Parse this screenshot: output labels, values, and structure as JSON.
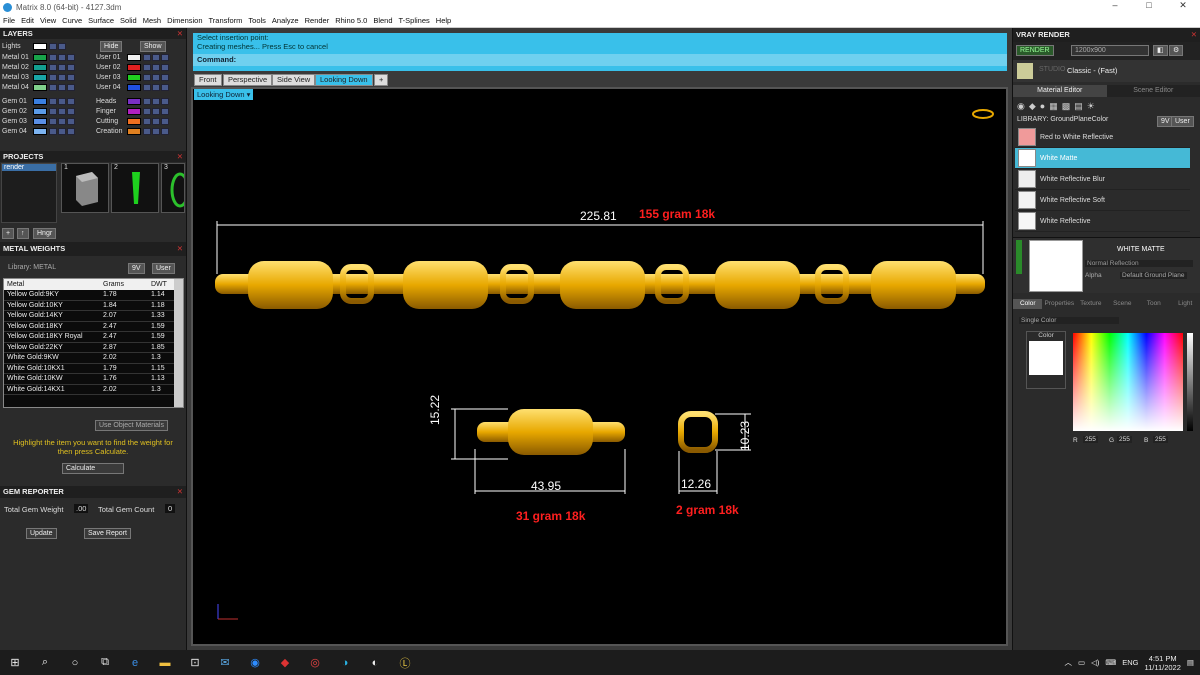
{
  "window": {
    "title": "Matrix 8.0 (64-bit) - 4127.3dm",
    "min": "–",
    "max": "□",
    "close": "✕"
  },
  "menu": [
    "File",
    "Edit",
    "View",
    "Curve",
    "Surface",
    "Solid",
    "Mesh",
    "Dimension",
    "Transform",
    "Tools",
    "Analyze",
    "Render",
    "Rhino 5.0",
    "Blend",
    "T-Splines",
    "Help"
  ],
  "layers": {
    "title": "LAYERS",
    "lights": "Lights",
    "hide": "Hide",
    "show": "Show",
    "col1": [
      {
        "name": "Metal 01",
        "color": "#18a34a"
      },
      {
        "name": "Metal 02",
        "color": "#139f8f"
      },
      {
        "name": "Metal 03",
        "color": "#19a5a5"
      },
      {
        "name": "Metal 04",
        "color": "#7fd08a"
      },
      {
        "name": "Gem 01",
        "color": "#3a7fe0"
      },
      {
        "name": "Gem 02",
        "color": "#5b9be8"
      },
      {
        "name": "Gem 03",
        "color": "#5a8fe6"
      },
      {
        "name": "Gem 04",
        "color": "#7cb3f0"
      }
    ],
    "col2": [
      {
        "name": "User 01",
        "color": "#f0f0f0"
      },
      {
        "name": "User 02",
        "color": "#e02020"
      },
      {
        "name": "User 03",
        "color": "#20d020"
      },
      {
        "name": "User 04",
        "color": "#2050e0"
      },
      {
        "name": "Heads",
        "color": "#7a2fc4"
      },
      {
        "name": "Finger",
        "color": "#b020c0"
      },
      {
        "name": "Cutting",
        "color": "#f07020"
      },
      {
        "name": "Creation",
        "color": "#e08020"
      }
    ]
  },
  "projects": {
    "title": "PROJECTS",
    "item": "render",
    "thumbs": [
      "1",
      "2",
      "3"
    ],
    "hingr": "Hngr"
  },
  "metal_weights": {
    "title": "METAL WEIGHTS",
    "library": "Library: METAL",
    "9v": "9V",
    "user": "User",
    "headers": [
      "Metal",
      "Grams",
      "DWT"
    ],
    "rows": [
      [
        "Yellow Gold:9KY",
        "1.78",
        "1.14"
      ],
      [
        "Yellow Gold:10KY",
        "1.84",
        "1.18"
      ],
      [
        "Yellow Gold:14KY",
        "2.07",
        "1.33"
      ],
      [
        "Yellow Gold:18KY",
        "2.47",
        "1.59"
      ],
      [
        "Yellow Gold:18KY Royal",
        "2.47",
        "1.59"
      ],
      [
        "Yellow Gold:22KY",
        "2.87",
        "1.85"
      ],
      [
        "White Gold:9KW",
        "2.02",
        "1.3"
      ],
      [
        "White Gold:10KX1",
        "1.79",
        "1.15"
      ],
      [
        "White Gold:10KW",
        "1.76",
        "1.13"
      ],
      [
        "White Gold:14KX1",
        "2.02",
        "1.3"
      ]
    ],
    "use_object": "Use Object Materials",
    "hint": "Highlight the item you want to find the weight for then press Calculate.",
    "calculate": "Calculate"
  },
  "gem_reporter": {
    "title": "GEM REPORTER",
    "total_weight_label": "Total Gem Weight",
    "total_weight": ".00",
    "total_count_label": "Total Gem Count",
    "total_count": "0",
    "update": "Update",
    "save": "Save Report"
  },
  "command": {
    "line1": "Select insertion point:",
    "line2": "Creating meshes... Press Esc to cancel",
    "label": "Command:"
  },
  "tabs": [
    "Front",
    "Perspective",
    "Side View",
    "Looking Down"
  ],
  "viewport_label": "Looking Down",
  "dims": {
    "total": "225.81",
    "total_weight": "155 gram 18k",
    "h1": "15.22",
    "w1": "43.95",
    "w1_weight": "31 gram 18k",
    "h2": "10.23",
    "w2": "12.26",
    "w2_weight": "2 gram 18k"
  },
  "vray": {
    "title": "VRAY RENDER",
    "render": "RENDER",
    "size": "1200x900",
    "preset_a": "STUDIO",
    "preset": "Classic - (Fast)",
    "tab1": "Material Editor",
    "tab2": "Scene Editor",
    "library": "LIBRARY: GroundPlaneColor",
    "9v": "9V",
    "user": "User",
    "materials": [
      {
        "name": "Red to White Reflective",
        "color": "#f09a9a"
      },
      {
        "name": "White Matte",
        "color": "#ffffff"
      },
      {
        "name": "White Reflective Blur",
        "color": "#eeeeee"
      },
      {
        "name": "White Reflective Soft",
        "color": "#f2f2f2"
      },
      {
        "name": "White Reflective",
        "color": "#f6f6f6"
      }
    ],
    "selected": "WHITE MATTE",
    "normal": "Normal Reflection",
    "alpha": "Alpha",
    "default_ground": "Default Ground Plane",
    "subtabs": [
      "Color",
      "Properties",
      "Texture",
      "Scene",
      "Toon",
      "Light"
    ],
    "single_color": "Single Color",
    "color_label": "Color",
    "r": "255",
    "g": "255",
    "b": "255",
    "r_label": "R",
    "g_label": "G",
    "b_label": "B"
  },
  "taskbar": {
    "time": "4:51 PM",
    "date": "11/11/2022",
    "lang": "ENG"
  }
}
